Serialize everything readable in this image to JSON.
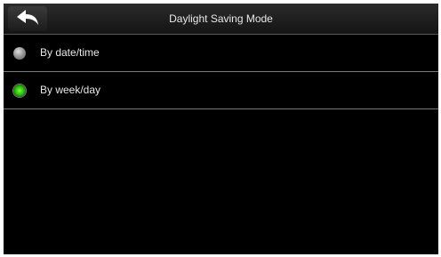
{
  "header": {
    "title": "Daylight Saving Mode",
    "back_icon": "back-arrow-icon"
  },
  "options": [
    {
      "label": "By date/time",
      "selected": false
    },
    {
      "label": "By week/day",
      "selected": true
    }
  ],
  "colors": {
    "background": "#000000",
    "text": "#e8e8e8",
    "selected_radio": "#2fbf10",
    "divider": "#7a7a7a"
  }
}
